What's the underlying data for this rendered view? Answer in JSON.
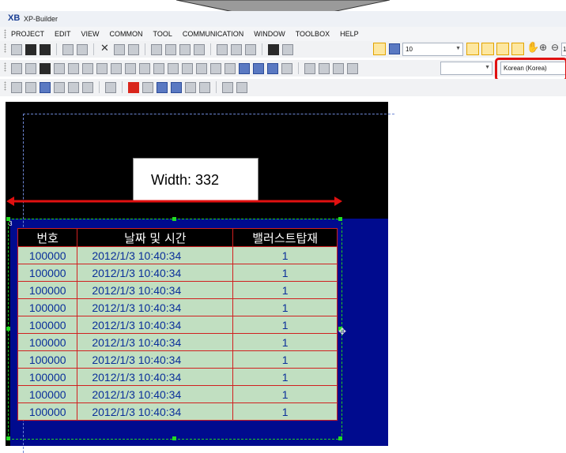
{
  "app": {
    "logo": "XB",
    "title": "XP-Builder"
  },
  "menu": [
    "PROJECT",
    "EDIT",
    "VIEW",
    "COMMON",
    "TOOL",
    "COMMUNICATION",
    "WINDOW",
    "TOOLBOX",
    "HELP"
  ],
  "toolbar": {
    "font_size_value": "10",
    "zoom_value": "1",
    "font_name_value": "",
    "language_value": "Korean (Korea)"
  },
  "canvas": {
    "width_label": "Width: 332",
    "object_index": "3",
    "colors": {
      "black_area": "#000000",
      "blue_area": "#000b8e",
      "selection": "#22dd22",
      "arrow": "#e01010"
    }
  },
  "table": {
    "headers": [
      "번호",
      "날짜 및 시간",
      "밸러스트탑재"
    ],
    "rows": [
      [
        "100000",
        "2012/1/3  10:40:34",
        "1"
      ],
      [
        "100000",
        "2012/1/3  10:40:34",
        "1"
      ],
      [
        "100000",
        "2012/1/3  10:40:34",
        "1"
      ],
      [
        "100000",
        "2012/1/3  10:40:34",
        "1"
      ],
      [
        "100000",
        "2012/1/3  10:40:34",
        "1"
      ],
      [
        "100000",
        "2012/1/3  10:40:34",
        "1"
      ],
      [
        "100000",
        "2012/1/3  10:40:34",
        "1"
      ],
      [
        "100000",
        "2012/1/3  10:40:34",
        "1"
      ],
      [
        "100000",
        "2012/1/3  10:40:34",
        "1"
      ],
      [
        "100000",
        "2012/1/3  10:40:34",
        "1"
      ]
    ]
  }
}
